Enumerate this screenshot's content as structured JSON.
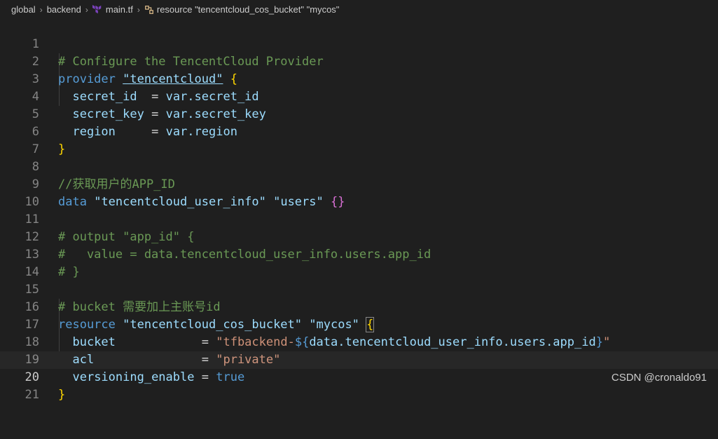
{
  "breadcrumb": {
    "items": [
      "global",
      "backend",
      "main.tf",
      "resource \"tencentcloud_cos_bucket\" \"mycos\""
    ]
  },
  "code": {
    "lines": [
      {
        "n": "1",
        "t": "# Configure the TencentCloud Provider"
      },
      {
        "n": "2",
        "t": "provider \"tencentcloud\" {"
      },
      {
        "n": "3",
        "t": "  secret_id  = var.secret_id"
      },
      {
        "n": "4",
        "t": "  secret_key = var.secret_key"
      },
      {
        "n": "5",
        "t": "  region     = var.region"
      },
      {
        "n": "6",
        "t": "}"
      },
      {
        "n": "7",
        "t": ""
      },
      {
        "n": "8",
        "t": "//获取用户的APP_ID"
      },
      {
        "n": "9",
        "t": "data \"tencentcloud_user_info\" \"users\" {}"
      },
      {
        "n": "10",
        "t": ""
      },
      {
        "n": "11",
        "t": "# output \"app_id\" {"
      },
      {
        "n": "12",
        "t": "#   value = data.tencentcloud_user_info.users.app_id"
      },
      {
        "n": "13",
        "t": "# }"
      },
      {
        "n": "14",
        "t": ""
      },
      {
        "n": "15",
        "t": "# bucket 需要加上主账号id"
      },
      {
        "n": "16",
        "t": "resource \"tencentcloud_cos_bucket\" \"mycos\" {"
      },
      {
        "n": "17",
        "t": "  bucket            = \"tfbackend-${data.tencentcloud_user_info.users.app_id}\""
      },
      {
        "n": "18",
        "t": "  acl               = \"private\""
      },
      {
        "n": "19",
        "t": "  versioning_enable = true"
      },
      {
        "n": "20",
        "t": "}"
      },
      {
        "n": "21",
        "t": ""
      }
    ]
  },
  "watermark": "CSDN @cronaldo91",
  "colors": {
    "background": "#1f1f1f",
    "comment": "#6a9955",
    "keyword": "#569cd6",
    "string": "#ce9178",
    "brace": "#ffd700"
  },
  "icons": {
    "file": "terraform-icon",
    "symbol": "resource-symbol-icon"
  }
}
